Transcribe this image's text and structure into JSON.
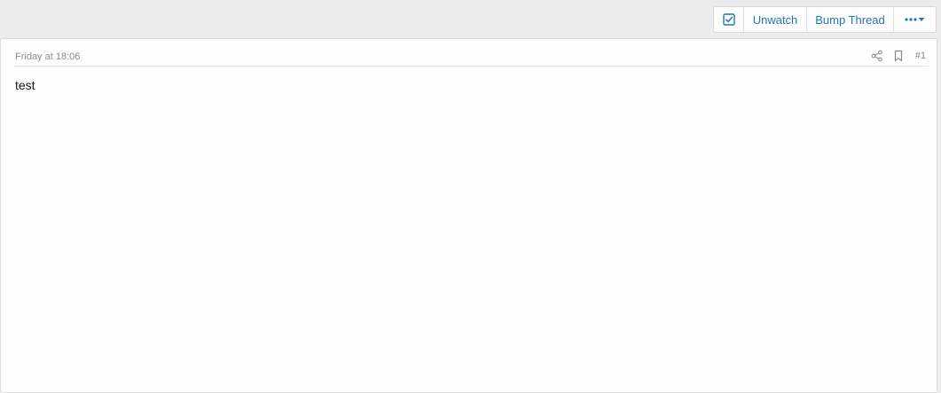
{
  "toolbar": {
    "check_icon": "checkbox-icon",
    "unwatch_label": "Unwatch",
    "bump_label": "Bump Thread",
    "more_icon": "ellipsis-dropdown-icon"
  },
  "post": {
    "date": "Friday at 18:06",
    "share_icon": "share-icon",
    "bookmark_icon": "bookmark-icon",
    "number": "#1",
    "content": "test"
  },
  "colors": {
    "accent": "#2577b1",
    "muted": "#8c8c8c",
    "page_bg": "#ececec"
  }
}
